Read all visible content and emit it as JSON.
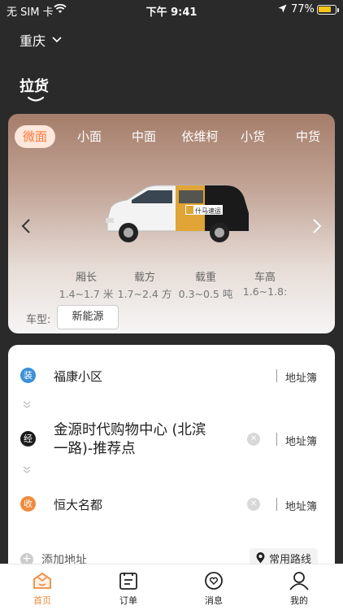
{
  "status_bar": {
    "carrier": "无 SIM 卡",
    "time": "下午 9:41",
    "battery": "77%",
    "battery_level": 0.77
  },
  "header": {
    "city": "重庆",
    "tab_title": "拉货"
  },
  "vehicle": {
    "tabs": [
      "微面",
      "小面",
      "中面",
      "依维柯",
      "小货",
      "中货"
    ],
    "active_index": 0,
    "brand_text": "什马速运",
    "specs": [
      {
        "label": "厢长",
        "value": "1.4~1.7 米"
      },
      {
        "label": "载方",
        "value": "1.7~2.4 方"
      },
      {
        "label": "载重",
        "value": "0.3~0.5 吨"
      },
      {
        "label": "车高",
        "value": "1.6~1.8:"
      }
    ],
    "model_label": "车型:",
    "model_option": "新能源",
    "accent_color": "#ff7a3c"
  },
  "address": {
    "load": {
      "badge": "装",
      "text": "福康小区",
      "book": "地址簿",
      "color": "#3a8fd8"
    },
    "via": {
      "badge": "经",
      "text_line1": "金源时代购物中心 (北滨",
      "text_line2": "一路)-推荐点",
      "book": "地址簿",
      "color": "#1b1b1b"
    },
    "unload": {
      "badge": "收",
      "text": "恒大名都",
      "book": "地址簿",
      "color": "#f08a3c"
    },
    "add_label": "添加地址",
    "common_route": "常用路线"
  },
  "nav": [
    {
      "label": "首页",
      "icon": "home-icon"
    },
    {
      "label": "订单",
      "icon": "order-icon"
    },
    {
      "label": "消息",
      "icon": "message-icon"
    },
    {
      "label": "我的",
      "icon": "profile-icon"
    }
  ]
}
